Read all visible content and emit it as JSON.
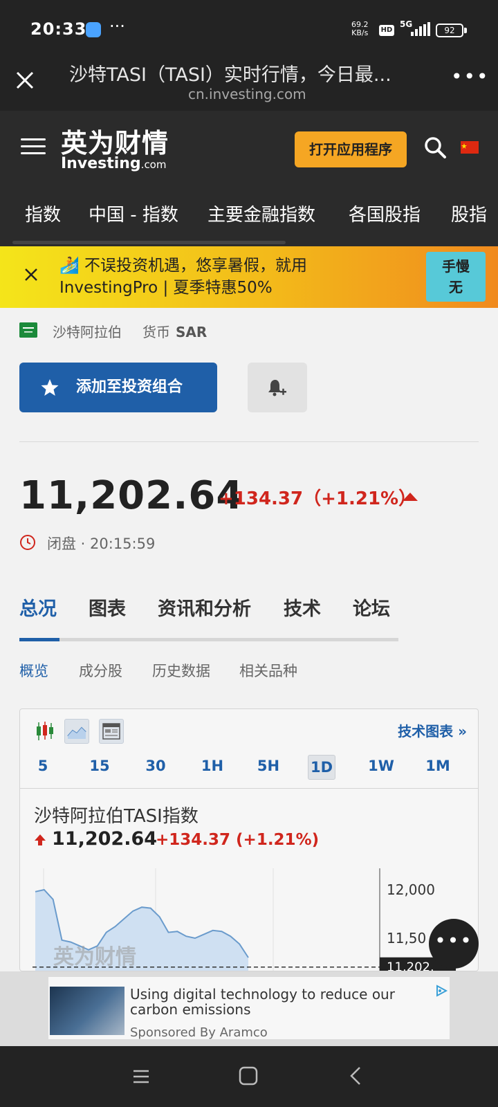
{
  "status_bar": {
    "time": "20:33",
    "more": "···",
    "speed_value": "69.2",
    "speed_unit": "KB/s",
    "hd": "HD",
    "network": "5G",
    "battery": "92"
  },
  "browser": {
    "title": "沙特TASI（TASI）实时行情，今日最...",
    "url": "cn.investing.com",
    "more": "•••"
  },
  "site": {
    "logo_cn": "英为财情",
    "logo_en": "Investing",
    "logo_en_suffix": ".com",
    "open_app": "打开应用程序"
  },
  "nav": {
    "items": [
      "指数",
      "中国 - 指数",
      "主要金融指数",
      "各国股指",
      "股指"
    ]
  },
  "promo": {
    "line1": "🏄 不误投资机遇，悠享暑假，就用",
    "line2": "InvestingPro | 夏季特惠50%",
    "button_line1": "手慢",
    "button_line2": "无"
  },
  "info": {
    "country": "沙特阿拉伯",
    "currency_label": "货币",
    "currency_value": "SAR"
  },
  "actions": {
    "add_portfolio": "添加至投资组合"
  },
  "quote": {
    "price": "11,202.64",
    "change": "+134.37（+1.21%）",
    "status": "闭盘 · 20:15:59"
  },
  "tabs": [
    "总况",
    "图表",
    "资讯和分析",
    "技术",
    "论坛"
  ],
  "subtabs": [
    "概览",
    "成分股",
    "历史数据",
    "相关品种"
  ],
  "chart_card": {
    "tech_link": "技术图表 »",
    "periods": [
      "5",
      "15",
      "30",
      "1H",
      "5H",
      "1D",
      "1W",
      "1M"
    ],
    "selected_period": "1D",
    "title": "沙特阿拉伯TASI指数",
    "price": "11,202.64",
    "change": "+134.37 (+1.21%)",
    "watermark": "英为财情"
  },
  "chart_data": {
    "type": "area",
    "y_ticks": [
      "12,000",
      "11,50",
      "11,202."
    ],
    "ylim": [
      11150,
      12150
    ],
    "values": [
      11980,
      12000,
      11900,
      11480,
      11460,
      11420,
      11380,
      11420,
      11560,
      11620,
      11700,
      11780,
      11820,
      11810,
      11720,
      11560,
      11570,
      11520,
      11500,
      11540,
      11580,
      11570,
      11520,
      11440,
      11300
    ]
  },
  "ad": {
    "title": "Using digital technology to reduce our carbon emissions",
    "sponsor": "Sponsored By Aramco"
  },
  "fab": "•••",
  "colors": {
    "accent": "#1f5fa8",
    "up": "#d0261d",
    "orange_button": "#f5a623"
  }
}
